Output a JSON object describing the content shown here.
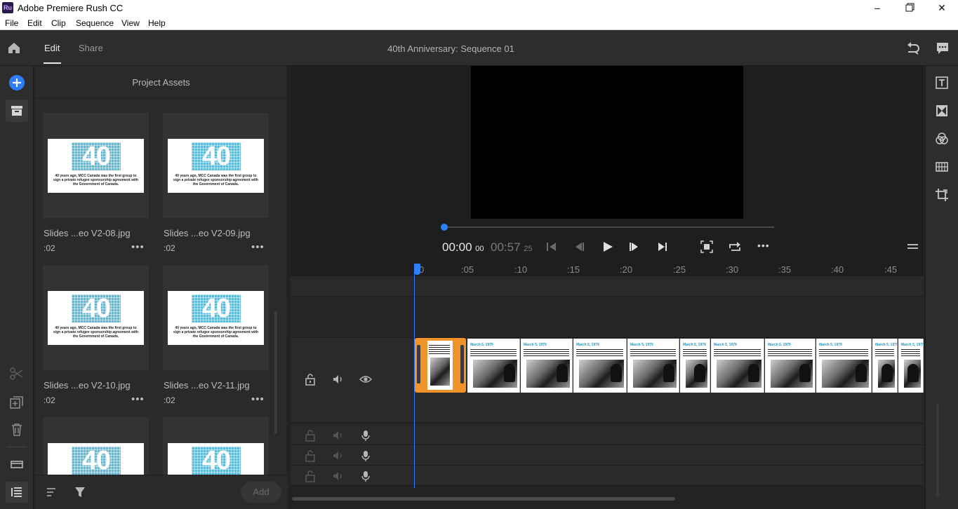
{
  "window": {
    "title": "Adobe Premiere Rush CC",
    "logo_text": "Ru",
    "controls": [
      "minimize-icon",
      "restore-icon",
      "close-icon"
    ]
  },
  "menu": [
    "File",
    "Edit",
    "Clip",
    "Sequence",
    "View",
    "Help"
  ],
  "header": {
    "tabs": [
      {
        "label": "Edit",
        "active": true
      },
      {
        "label": "Share",
        "active": false
      }
    ],
    "sequence_title": "40th Anniversary: Sequence 01"
  },
  "assets": {
    "panel_title": "Project Assets",
    "add_label": "Add",
    "slide": {
      "big_number": "40",
      "caption": "40 years ago, MCC Canada was the first group to sign a private refugee sponsorship agreement with the Government of Canada."
    },
    "items": [
      {
        "name": "Slides ...eo V2-08.jpg",
        "duration": ":02"
      },
      {
        "name": "Slides ...eo V2-09.jpg",
        "duration": ":02"
      },
      {
        "name": "Slides ...eo V2-10.jpg",
        "duration": ":02"
      },
      {
        "name": "Slides ...eo V2-11.jpg",
        "duration": ":02"
      },
      {
        "name": "",
        "duration": ""
      },
      {
        "name": "",
        "duration": ""
      }
    ]
  },
  "player": {
    "current_time": "00:00",
    "current_frames": "00",
    "duration_time": "00:57",
    "duration_frames": "25",
    "more": "..."
  },
  "timeline": {
    "ruler_ticks": [
      "0",
      ":05",
      ":10",
      ":15",
      ":20",
      ":25",
      ":30",
      ":35",
      ":40",
      ":45"
    ],
    "clip_header": "March 5, 1979"
  },
  "colors": {
    "accent_blue": "#2d7ff9",
    "selected_clip": "#f0932b",
    "slide_teal": "#5db8d6"
  }
}
